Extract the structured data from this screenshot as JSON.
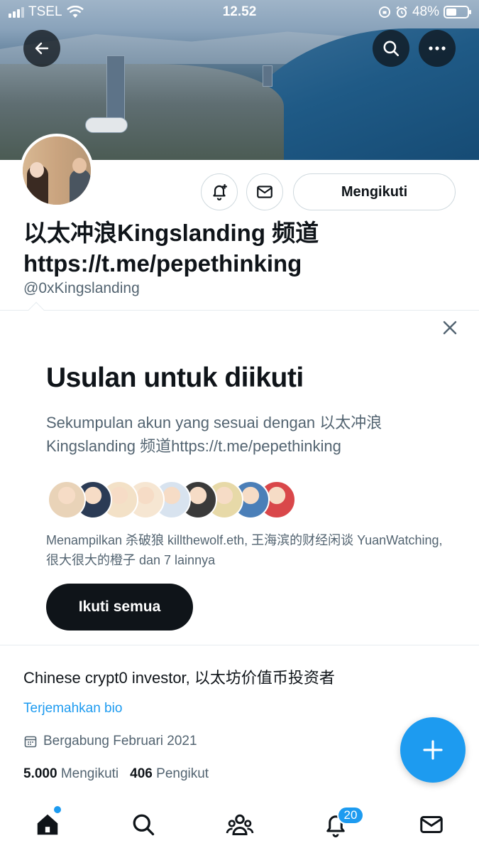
{
  "status_bar": {
    "carrier": "TSEL",
    "time": "12.52",
    "battery": "48%"
  },
  "profile": {
    "display_name": "以太冲浪Kingslanding 频道https://t.me/pepethinking",
    "handle": "@0xKingslanding",
    "follow_state_label": "Mengikuti",
    "bio": "Chinese crypt0 investor, 以太坊价值币投资者",
    "translate_label": "Terjemahkan bio",
    "joined": "Bergabung Februari 2021",
    "following_count": "5.000",
    "following_label": "Mengikuti",
    "followers_count": "406",
    "followers_label": "Pengikut"
  },
  "suggestions": {
    "title": "Usulan untuk diikuti",
    "description": "Sekumpulan akun yang sesuai dengan 以太冲浪 Kingslanding 频道https://t.me/pepethinking",
    "shown_text": "Menampilkan 杀破狼 killthewolf.eth, 王海滨的财经闲谈 YuanWatching, 很大很大的橙子 dan 7 lainnya",
    "follow_all_label": "Ikuti semua",
    "avatar_colors": [
      "#e9d3b8",
      "#2b3b55",
      "#f3e1c7",
      "#f6e6d2",
      "#d8e3ef",
      "#3a3a3a",
      "#e7d9a8",
      "#4b7fb8",
      "#d9474a"
    ]
  },
  "tab_bar": {
    "notifications_badge": "20"
  },
  "colors": {
    "accent": "#1d9bf0",
    "text": "#0f1419",
    "secondary": "#536471",
    "border": "#cfd9de"
  }
}
